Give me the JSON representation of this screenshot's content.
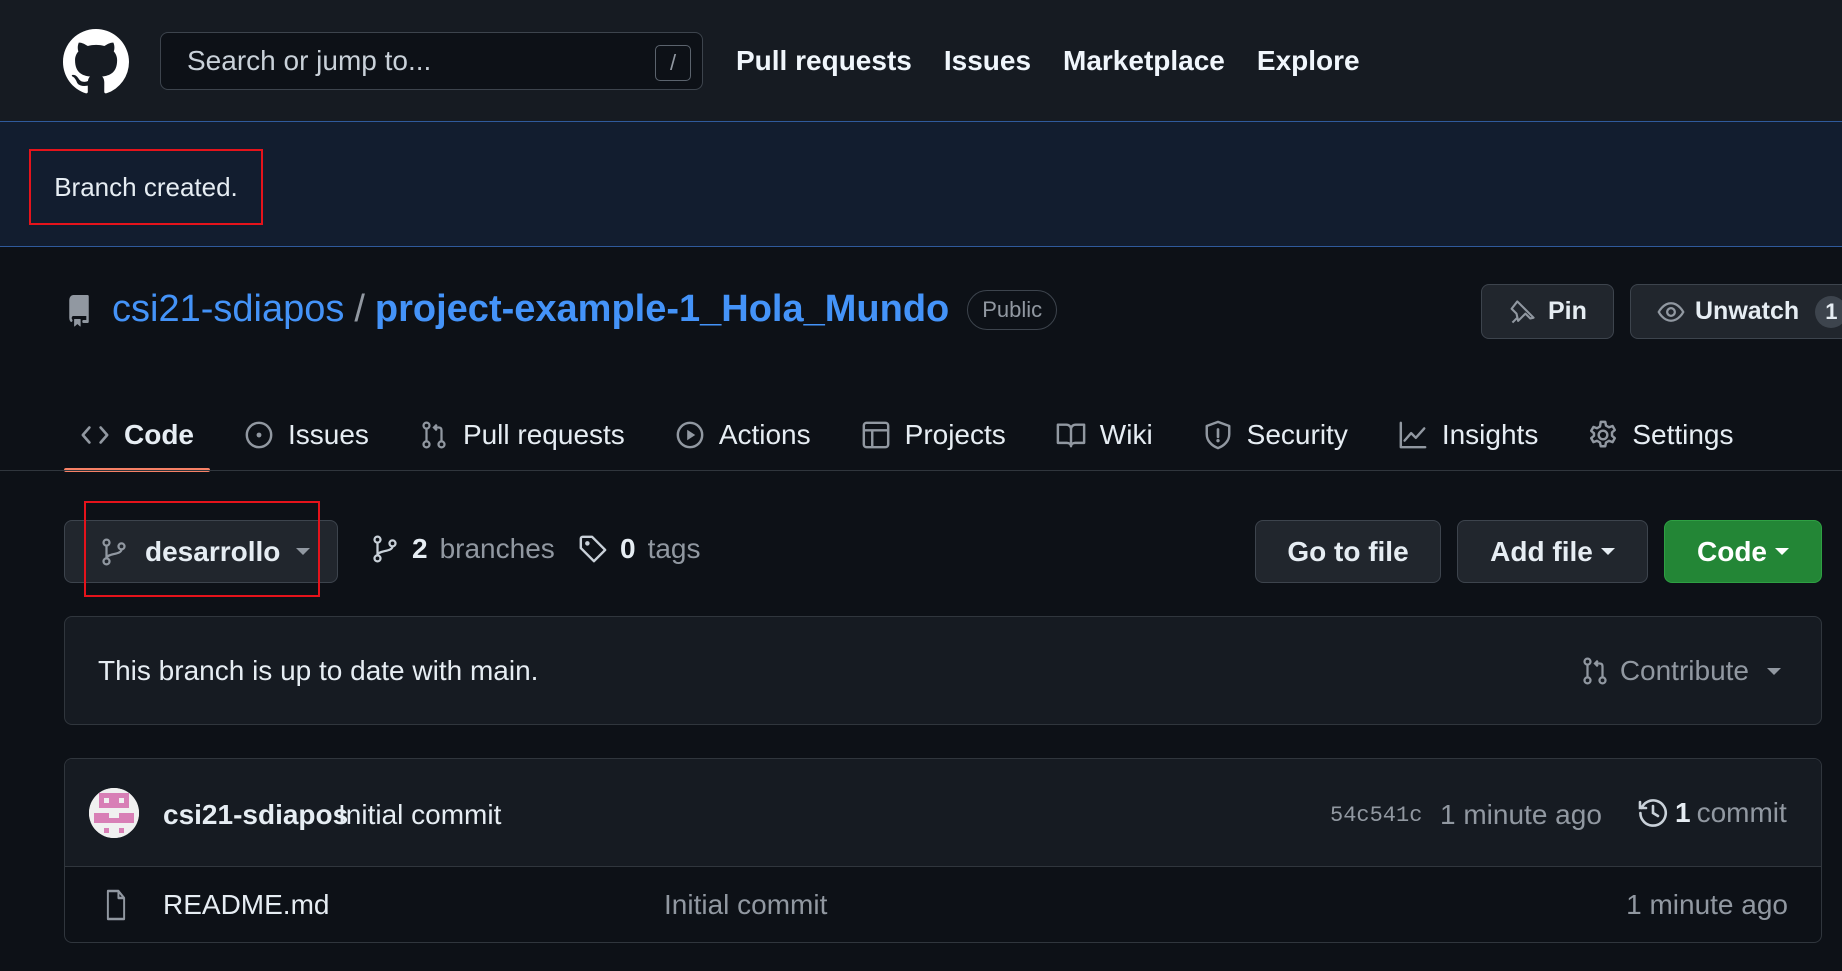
{
  "header": {
    "search_placeholder": "Search or jump to...",
    "search_shortcut": "/",
    "nav": [
      "Pull requests",
      "Issues",
      "Marketplace",
      "Explore"
    ]
  },
  "flash": {
    "message": "Branch created."
  },
  "repo": {
    "owner": "csi21-sdiapos",
    "separator": "/",
    "name": "project-example-1_Hola_Mundo",
    "visibility": "Public",
    "pin_label": "Pin",
    "unwatch_label": "Unwatch",
    "watch_count": "1"
  },
  "tabs": [
    {
      "label": "Code",
      "icon": "code-icon",
      "active": true
    },
    {
      "label": "Issues",
      "icon": "issue-icon"
    },
    {
      "label": "Pull requests",
      "icon": "pull-request-icon"
    },
    {
      "label": "Actions",
      "icon": "play-icon"
    },
    {
      "label": "Projects",
      "icon": "table-icon"
    },
    {
      "label": "Wiki",
      "icon": "book-icon"
    },
    {
      "label": "Security",
      "icon": "shield-icon"
    },
    {
      "label": "Insights",
      "icon": "graph-icon"
    },
    {
      "label": "Settings",
      "icon": "gear-icon"
    }
  ],
  "branch_bar": {
    "current_branch": "desarrollo",
    "branches_count": "2",
    "branches_label": "branches",
    "tags_count": "0",
    "tags_label": "tags",
    "go_to_file": "Go to file",
    "add_file": "Add file",
    "code": "Code"
  },
  "status": {
    "message": "This branch is up to date with main.",
    "contribute": "Contribute"
  },
  "commit": {
    "author": "csi21-sdiapos",
    "message": "Initial commit",
    "sha": "54c541c",
    "time": "1 minute ago",
    "count": "1",
    "count_label": "commit"
  },
  "files": [
    {
      "name": "README.md",
      "message": "Initial commit",
      "time": "1 minute ago"
    }
  ],
  "colors": {
    "accent_link": "#4493f8",
    "primary_button": "#238636",
    "active_tab_underline": "#f78166",
    "highlight_border": "#e5131b"
  }
}
